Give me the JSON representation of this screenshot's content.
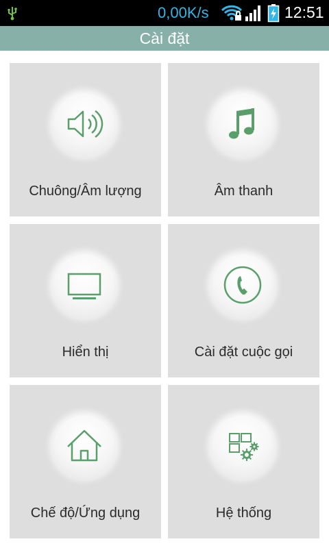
{
  "status_bar": {
    "net_speed": "0,00K/s",
    "time": "12:51",
    "icons": [
      "usb-icon",
      "wifi-icon",
      "signal-icon",
      "battery-charging-icon"
    ]
  },
  "header": {
    "title": "Cài đặt"
  },
  "colors": {
    "accent_green": "#5a9f6a",
    "title_bar": "#86b0a8",
    "tile_background": "#dedede",
    "status_text_blue": "#33b5e5"
  },
  "tiles": [
    {
      "label": "Chuông/Âm lượng",
      "icon": "speaker-volume-icon"
    },
    {
      "label": "Âm thanh",
      "icon": "music-note-icon"
    },
    {
      "label": "Hiển thị",
      "icon": "display-monitor-icon"
    },
    {
      "label": "Cài đặt cuộc gọi",
      "icon": "phone-call-icon"
    },
    {
      "label": "Chế độ/Ứng dụng",
      "icon": "home-icon"
    },
    {
      "label": "Hệ thống",
      "icon": "system-gear-icon"
    }
  ]
}
